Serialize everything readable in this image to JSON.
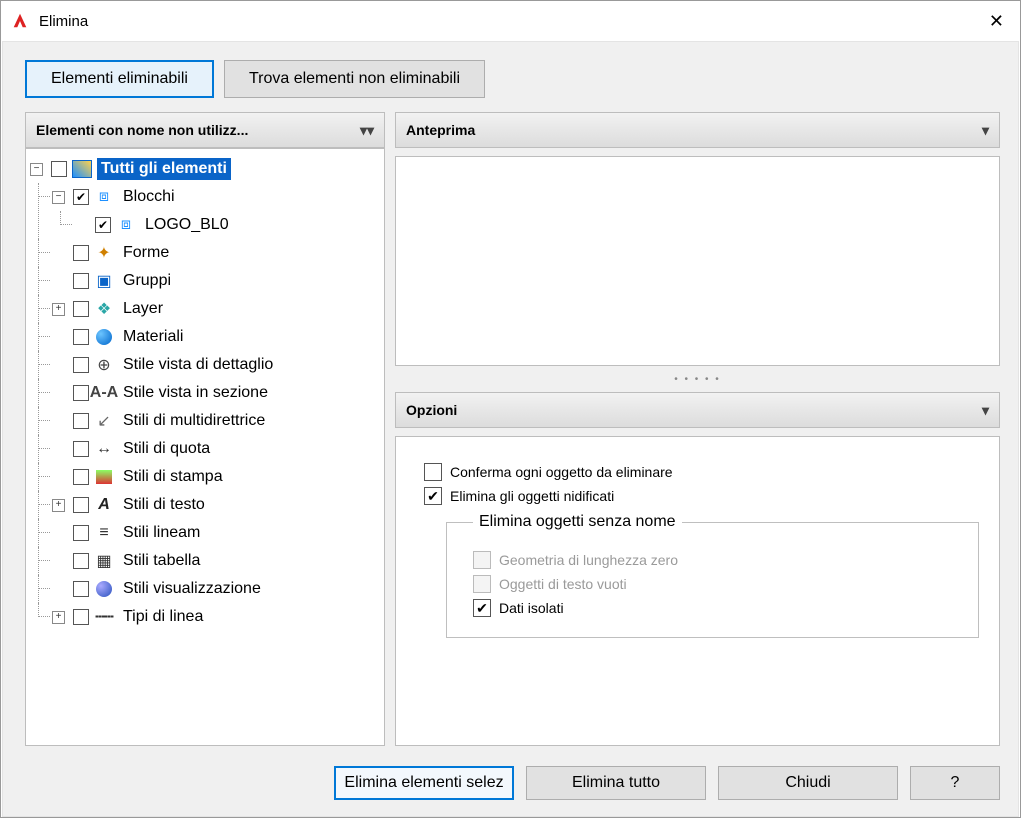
{
  "window": {
    "title": "Elimina"
  },
  "tabs": {
    "purgeable": "Elementi eliminabili",
    "find_non": "Trova elementi non eliminabili"
  },
  "left_panel": {
    "header": "Elementi con nome non utilizz..."
  },
  "tree": {
    "root": "Tutti gli elementi",
    "blocchi": "Blocchi",
    "logo": "LOGO_BL0",
    "forme": "Forme",
    "gruppi": "Gruppi",
    "layer": "Layer",
    "materiali": "Materiali",
    "stile_det": "Stile vista di dettaglio",
    "stile_sez": "Stile vista in sezione",
    "stili_mld": "Stili di multidirettrice",
    "stili_quota": "Stili di quota",
    "stili_stampa": "Stili di stampa",
    "stili_testo": "Stili di testo",
    "stili_lineam": "Stili lineam",
    "stili_tab": "Stili tabella",
    "stili_vis": "Stili visualizzazione",
    "tipi_linea": "Tipi di linea"
  },
  "right": {
    "preview_header": "Anteprima",
    "options_header": "Opzioni"
  },
  "options": {
    "confirm": "Conferma ogni oggetto da eliminare",
    "nested": "Elimina gli oggetti nidificati",
    "unnamed_legend": "Elimina oggetti senza nome",
    "zero_geom": "Geometria di lunghezza zero",
    "empty_text": "Oggetti di testo vuoti",
    "orphan": "Dati isolati"
  },
  "buttons": {
    "purge_sel": "Elimina elementi selez",
    "purge_all": "Elimina tutto",
    "close": "Chiudi",
    "help": "?"
  }
}
